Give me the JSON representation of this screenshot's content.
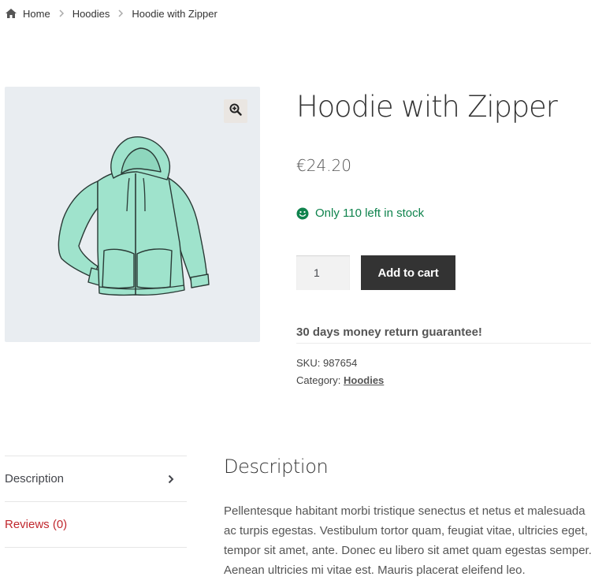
{
  "breadcrumb": {
    "icon": "home-icon",
    "items": [
      "Home",
      "Hoodies"
    ],
    "current": "Hoodie with Zipper"
  },
  "gallery": {
    "zoom_icon": "zoom-in-icon",
    "image": "hoodie-with-zipper-illustration"
  },
  "product": {
    "title": "Hoodie with Zipper",
    "price": "€24.20",
    "stock_text": "Only 110 left in stock",
    "stock_icon": "smile-icon",
    "quantity": "1",
    "add_to_cart_label": "Add to cart",
    "guarantee": "30 days money return guarantee!",
    "sku_label": "SKU:",
    "sku_value": "987654",
    "category_label": "Category:",
    "category_value": "Hoodies"
  },
  "tabs": [
    {
      "label": "Description",
      "icon": "chevron-right-icon"
    },
    {
      "label": "Reviews (0)"
    }
  ],
  "description": {
    "title": "Description",
    "text": "Pellentesque habitant morbi tristique senectus et netus et malesuada ac turpis egestas. Vestibulum tortor quam, feugiat vitae, ultricies eget, tempor sit amet, ante. Donec eu libero sit amet quam egestas semper. Aenean ultricies mi vitae est. Mauris placerat eleifend leo."
  },
  "colors": {
    "stock_green": "#0f834d",
    "button_dark": "#333333",
    "reviews_red": "#c0272d",
    "gallery_bg": "#e9edf1",
    "hoodie_fill": "#9fe3cc"
  }
}
